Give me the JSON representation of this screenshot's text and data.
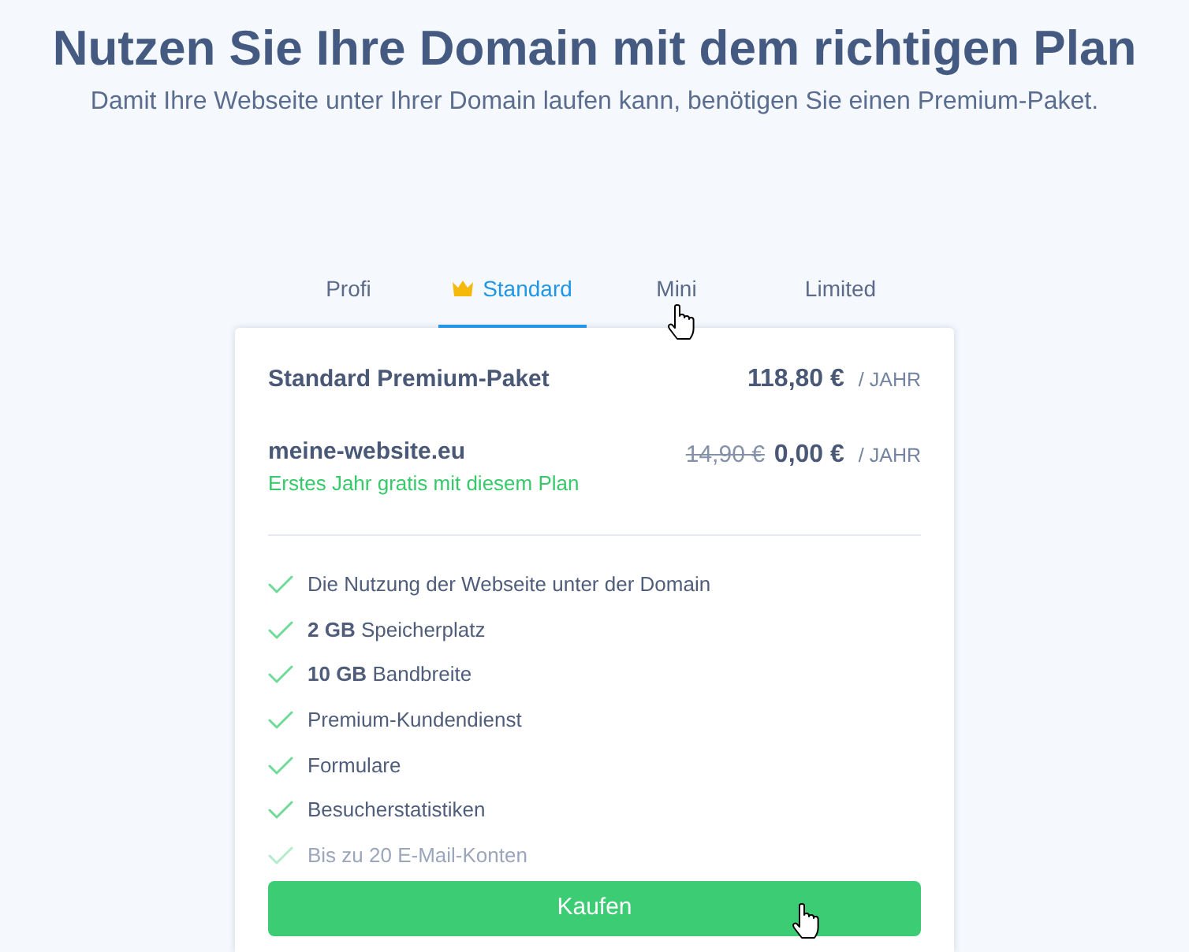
{
  "header": {
    "title": "Nutzen Sie Ihre Domain mit dem richtigen Plan",
    "subtitle": "Damit Ihre Webseite unter Ihrer Domain laufen kann, benötigen Sie einen Premium-Paket."
  },
  "tabs": [
    {
      "label": "Profi",
      "selected": false,
      "featured": false,
      "hovered": false
    },
    {
      "label": "Standard",
      "selected": true,
      "featured": true,
      "hovered": false
    },
    {
      "label": "Mini",
      "selected": false,
      "featured": false,
      "hovered": true
    },
    {
      "label": "Limited",
      "selected": false,
      "featured": false,
      "hovered": false
    }
  ],
  "plan": {
    "title": "Standard Premium-Paket",
    "price": "118,80 €",
    "period": "/ JAHR"
  },
  "domain": {
    "name": "meine-website.eu",
    "note": "Erstes Jahr gratis mit diesem Plan",
    "old_price": "14,90 €",
    "price": "0,00 €",
    "period": "/ JAHR"
  },
  "features": [
    {
      "text": "Die Nutzung der Webseite unter der Domain",
      "faded": false
    },
    {
      "text": "**2 GB** Speicherplatz",
      "faded": false
    },
    {
      "text": "**10 GB** Bandbreite",
      "faded": false
    },
    {
      "text": "Premium-Kundendienst",
      "faded": false
    },
    {
      "text": "Formulare",
      "faded": false
    },
    {
      "text": "Besucherstatistiken",
      "faded": false
    },
    {
      "text": "Bis zu 20 E-Mail-Konten",
      "faded": true
    }
  ],
  "button": {
    "label": "Kaufen",
    "hovered": true
  }
}
